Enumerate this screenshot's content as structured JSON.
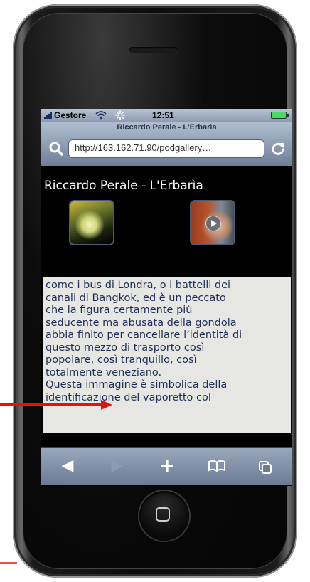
{
  "status_bar": {
    "carrier": "Gestore",
    "time": "12:51",
    "signal_icon": "signal-bars-icon",
    "wifi_icon": "wifi-icon",
    "activity_icon": "activity-spinner-icon",
    "battery_icon": "battery-icon"
  },
  "browser": {
    "page_title": "Riccardo Perale - L'Erbarìa",
    "url": "http://163.162.71.90/podgallery…",
    "search_icon": "search-icon",
    "reload_icon": "reload-icon"
  },
  "page": {
    "heading": "Riccardo Perale - L'Erbarìa",
    "thumbnails": [
      {
        "name": "photo-thumbnail",
        "type": "image"
      },
      {
        "name": "video-thumbnail",
        "type": "video"
      }
    ],
    "caption_lines": [
      "come i bus di Londra, o i battelli dei",
      "canali di Bangkok, ed è un peccato",
      "che la figura certamente più",
      "seducente ma abusata della gondola",
      "abbia finito per cancellare l’identità di",
      "questo mezzo di trasporto così",
      "popolare, così tranquillo, così",
      "totalmente veneziano.",
      "Questa immagine è simbolica della",
      "identificazione del vaporetto col"
    ]
  },
  "toolbar": {
    "back": "◀",
    "forward": "▶",
    "add": "+",
    "bookmarks": "📖",
    "pages": "⧉"
  },
  "colors": {
    "annotation_red": "#e8120c",
    "caption_text": "#1d2f57",
    "caption_bg": "#e6e6e3"
  }
}
